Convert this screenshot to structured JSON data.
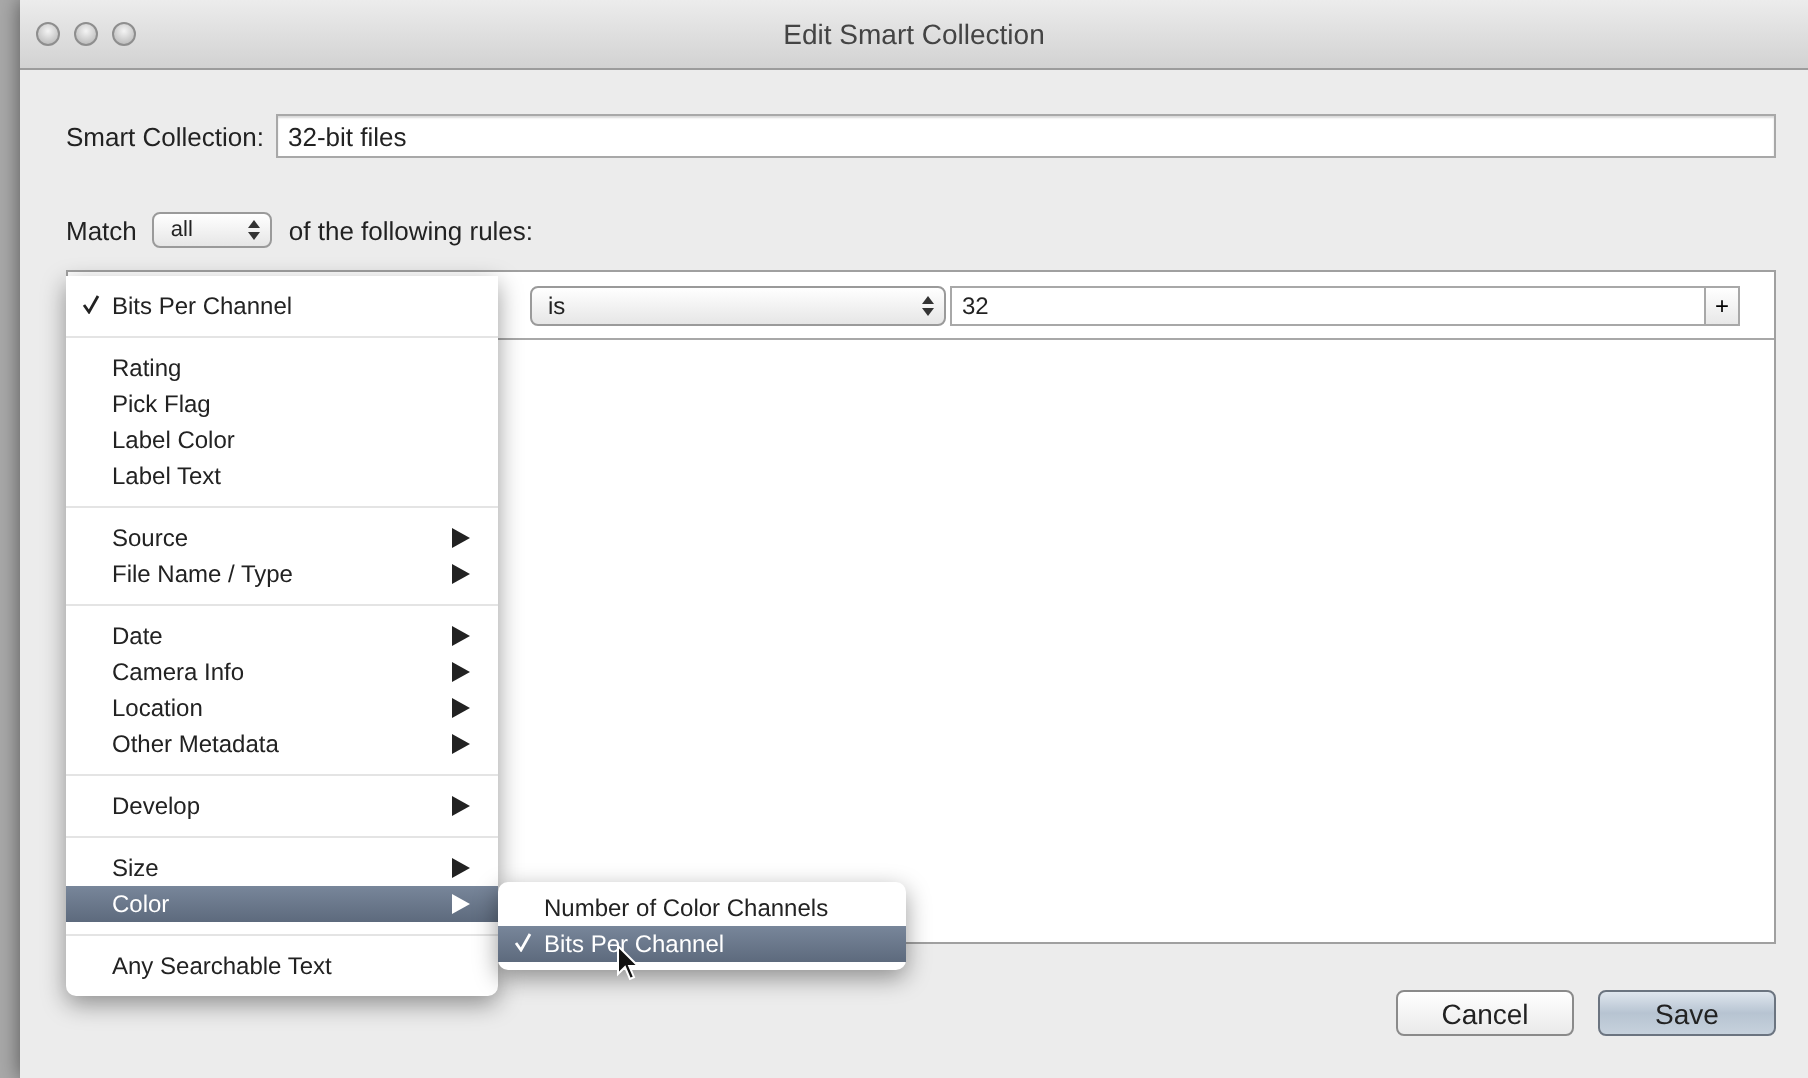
{
  "window": {
    "title": "Edit Smart Collection"
  },
  "name_field": {
    "label": "Smart Collection:",
    "value": "32-bit files"
  },
  "match": {
    "prefix": "Match",
    "value": "all",
    "suffix": "of the following rules:"
  },
  "rule": {
    "operator": "is",
    "value": "32",
    "add_button": "+"
  },
  "field_menu": {
    "groups": [
      [
        {
          "label": "Bits Per Channel",
          "checked": true,
          "submenu": false,
          "selected": false
        }
      ],
      [
        {
          "label": "Rating",
          "checked": false,
          "submenu": false,
          "selected": false
        },
        {
          "label": "Pick Flag",
          "checked": false,
          "submenu": false,
          "selected": false
        },
        {
          "label": "Label Color",
          "checked": false,
          "submenu": false,
          "selected": false
        },
        {
          "label": "Label Text",
          "checked": false,
          "submenu": false,
          "selected": false
        }
      ],
      [
        {
          "label": "Source",
          "checked": false,
          "submenu": true,
          "selected": false
        },
        {
          "label": "File Name / Type",
          "checked": false,
          "submenu": true,
          "selected": false
        }
      ],
      [
        {
          "label": "Date",
          "checked": false,
          "submenu": true,
          "selected": false
        },
        {
          "label": "Camera Info",
          "checked": false,
          "submenu": true,
          "selected": false
        },
        {
          "label": "Location",
          "checked": false,
          "submenu": true,
          "selected": false
        },
        {
          "label": "Other Metadata",
          "checked": false,
          "submenu": true,
          "selected": false
        }
      ],
      [
        {
          "label": "Develop",
          "checked": false,
          "submenu": true,
          "selected": false
        }
      ],
      [
        {
          "label": "Size",
          "checked": false,
          "submenu": true,
          "selected": false
        },
        {
          "label": "Color",
          "checked": false,
          "submenu": true,
          "selected": true
        }
      ],
      [
        {
          "label": "Any Searchable Text",
          "checked": false,
          "submenu": false,
          "selected": false
        }
      ]
    ]
  },
  "submenu": {
    "items": [
      {
        "label": "Number of Color Channels",
        "checked": false,
        "selected": false
      },
      {
        "label": "Bits Per Channel",
        "checked": true,
        "selected": true
      }
    ]
  },
  "buttons": [
    {
      "label": "Cancel",
      "default": false
    },
    {
      "label": "Save",
      "default": true
    }
  ]
}
